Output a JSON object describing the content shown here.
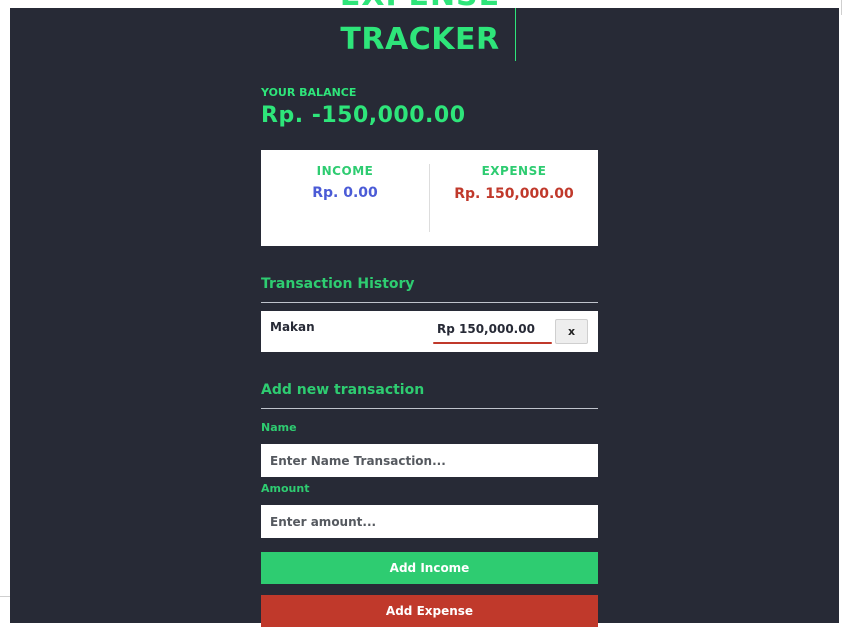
{
  "app": {
    "title_line1": "EXPENSE",
    "title_line2": "TRACKER"
  },
  "balance": {
    "label": "YOUR BALANCE",
    "value": "Rp. -150,000.00"
  },
  "summary": {
    "income_label": "INCOME",
    "income_value": "Rp. 0.00",
    "expense_label": "EXPENSE",
    "expense_value": "Rp. 150,000.00"
  },
  "history": {
    "title": "Transaction History",
    "items": [
      {
        "name": "Makan",
        "amount": "Rp 150,000.00",
        "delete_label": "x"
      }
    ]
  },
  "form": {
    "title": "Add new transaction",
    "name_label": "Name",
    "name_placeholder": "Enter Name Transaction...",
    "amount_label": "Amount",
    "amount_placeholder": "Enter amount...",
    "add_income_label": "Add Income",
    "add_expense_label": "Add Expense"
  },
  "colors": {
    "background": "#272a36",
    "accent_green": "#2ecc71",
    "income_blue": "#4b5bd6",
    "expense_red": "#c0392b"
  }
}
